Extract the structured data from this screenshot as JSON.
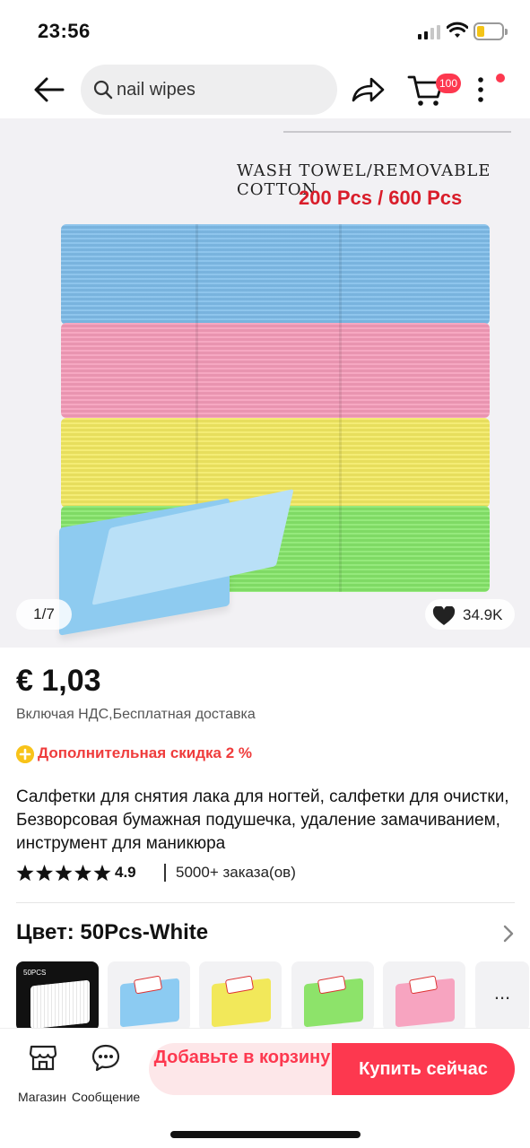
{
  "status_bar": {
    "time": "23:56",
    "battery_level": 0.3
  },
  "header": {
    "search_placeholder": "nail wipes",
    "cart_badge": "100",
    "icons": [
      "back-arrow-icon",
      "search-icon",
      "share-icon",
      "cart-icon",
      "more-icon"
    ]
  },
  "gallery": {
    "caption_line1": "WASH TOWEL/REMOVABLE COTTON",
    "caption_line2": "200 Pcs / 600 Pcs",
    "pager": "1/7",
    "likes": "34.9K",
    "stack_colors": [
      "#7fbdea",
      "#f59cb9",
      "#f3ea62",
      "#86e66a"
    ]
  },
  "product": {
    "price": "€ 1,03",
    "vat_note": "Включая НДС,Бесплатная доставка",
    "extra_discount": "Дополнительная скидка 2 %",
    "title": "Салфетки для снятия лака для ногтей, салфетки для очистки, Безворсовая бумажная подушечка, удаление замачиванием, инструмент для маникюра",
    "rating": "4.9",
    "rating_stars": 5,
    "orders": "5000+ заказа(ов)"
  },
  "variants": {
    "label": "Цвет: 50Pcs-White",
    "selected_tag": "50PCS",
    "more_label": "...",
    "colors": [
      "#ffffff",
      "#8ccbf2",
      "#f2e85a",
      "#8de36a",
      "#f7a4c0"
    ]
  },
  "bottom_bar": {
    "store_label": "Магазин",
    "messages_label": "Сообщение",
    "add_to_cart": "Добавьте в корзину",
    "buy_now": "Купить сейчас"
  },
  "colors": {
    "accent": "#fd384f",
    "accent_light": "#fde7e9",
    "discount_text": "#ef3c3c",
    "discount_icon": "#f8c31a"
  }
}
